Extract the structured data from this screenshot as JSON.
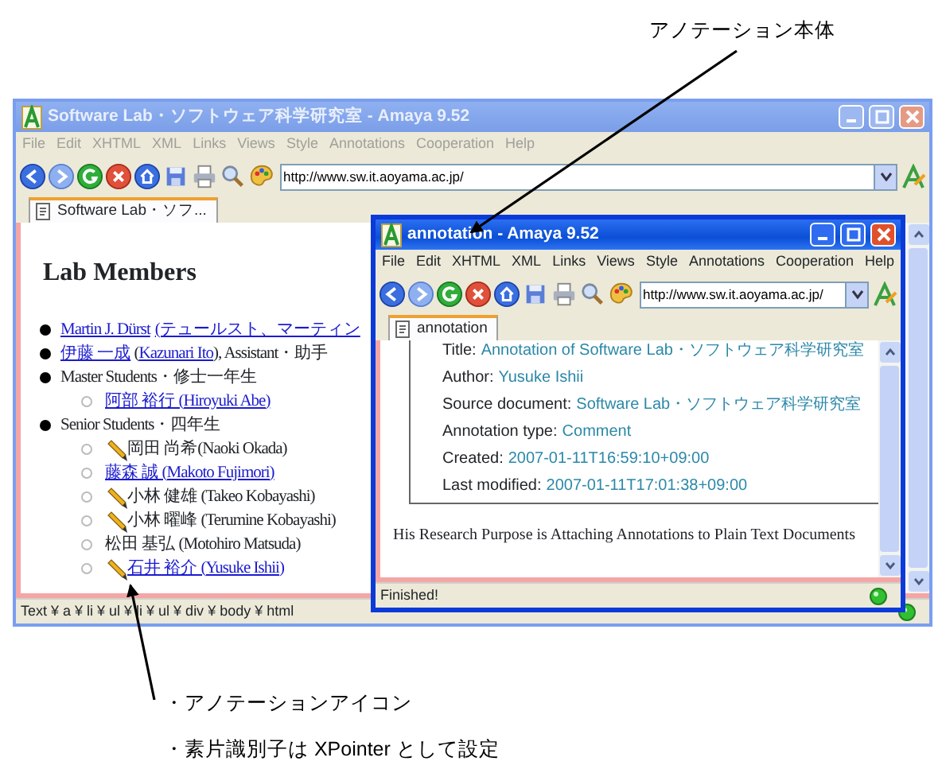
{
  "callouts": [
    {
      "text": "アノテーション本体"
    },
    {
      "text": "・アノテーションアイコン"
    },
    {
      "text": "・素片識別子は XPointer として設定"
    }
  ],
  "main_window": {
    "title": "Software Lab・ソフトウェア科学研究室 - Amaya 9.52",
    "active": false,
    "menu": [
      "File",
      "Edit",
      "XHTML",
      "XML",
      "Links",
      "Views",
      "Style",
      "Annotations",
      "Cooperation",
      "Help"
    ],
    "address": "http://www.sw.it.aoyama.ac.jp/",
    "tabs": [
      {
        "label": "Software Lab・ソフ...",
        "selected": true
      }
    ],
    "heading": "Lab Members",
    "members": [
      {
        "annotated": false,
        "parts": [
          {
            "kind": "link",
            "text": "Martin J. Dürst"
          },
          {
            "kind": "link",
            "text": "(テュールスト、マーティン"
          }
        ]
      },
      {
        "annotated": false,
        "parts": [
          {
            "kind": "link",
            "text": "伊藤 一成"
          },
          {
            "kind": "text",
            "text": " ("
          },
          {
            "kind": "link",
            "text": "Kazunari Ito"
          },
          {
            "kind": "text",
            "text": "), Assistant・助手"
          }
        ]
      },
      {
        "annotated": false,
        "parts": [
          {
            "kind": "text",
            "text": "Master Students・修士一年生"
          }
        ],
        "children": [
          {
            "annotated": false,
            "parts": [
              {
                "kind": "link",
                "text": "阿部 裕行 (Hiroyuki Abe)"
              }
            ]
          }
        ]
      },
      {
        "annotated": false,
        "parts": [
          {
            "kind": "text",
            "text": "Senior Students・四年生"
          }
        ],
        "children": [
          {
            "annotated": true,
            "parts": [
              {
                "kind": "text",
                "text": "岡田 尚希(Naoki Okada)"
              }
            ]
          },
          {
            "annotated": false,
            "parts": [
              {
                "kind": "link",
                "text": "藤森 誠 (Makoto Fujimori)"
              }
            ]
          },
          {
            "annotated": true,
            "parts": [
              {
                "kind": "text",
                "text": "小林 健雄 (Takeo Kobayashi)"
              }
            ]
          },
          {
            "annotated": true,
            "parts": [
              {
                "kind": "text",
                "text": "小林 曜峰 (Terumine Kobayashi)"
              }
            ]
          },
          {
            "annotated": false,
            "parts": [
              {
                "kind": "text",
                "text": "松田 基弘 (Motohiro Matsuda)"
              }
            ]
          },
          {
            "annotated": true,
            "parts": [
              {
                "kind": "link",
                "text": "石井 裕介 (Yusuke Ishii)"
              }
            ]
          }
        ]
      }
    ],
    "status": "Text ¥ a ¥ li ¥ ul ¥ li ¥ ul ¥ div ¥ body ¥ html"
  },
  "annotation_window": {
    "title": "annotation - Amaya 9.52",
    "active": true,
    "menu": [
      "File",
      "Edit",
      "XHTML",
      "XML",
      "Links",
      "Views",
      "Style",
      "Annotations",
      "Cooperation",
      "Help"
    ],
    "address": "http://www.sw.it.aoyama.ac.jp/",
    "tabs": [
      {
        "label": "annotation",
        "selected": true
      }
    ],
    "metadata": [
      {
        "label": "Title:",
        "value": "Annotation of Software Lab・ソフトウェア科学研究室"
      },
      {
        "label": "Author:",
        "value": "Yusuke Ishii"
      },
      {
        "label": "Source document:",
        "value": "Software Lab・ソフトウェア科学研究室"
      },
      {
        "label": "Annotation type:",
        "value": "Comment"
      },
      {
        "label": "Created:",
        "value": "2007-01-11T16:59:10+09:00"
      },
      {
        "label": "Last modified:",
        "value": "2007-01-11T17:01:38+09:00"
      }
    ],
    "body": "His Research Purpose is Attaching Annotations to Plain Text Documents",
    "status": "Finished!"
  }
}
